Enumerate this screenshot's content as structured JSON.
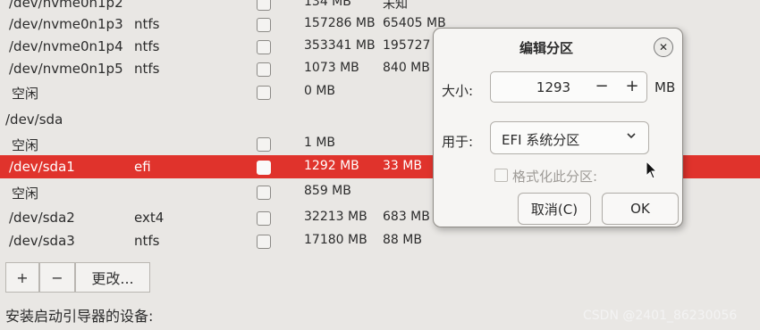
{
  "partitions": [
    {
      "device": "/dev/nvme0n1p2",
      "type": "",
      "size": "134 MB",
      "used": "未知",
      "selected": false
    },
    {
      "device": "/dev/nvme0n1p3",
      "type": "ntfs",
      "size": "157286 MB",
      "used": "65405 MB",
      "selected": false
    },
    {
      "device": "/dev/nvme0n1p4",
      "type": "ntfs",
      "size": "353341 MB",
      "used": "195727",
      "selected": false
    },
    {
      "device": "/dev/nvme0n1p5",
      "type": "ntfs",
      "size": "1073 MB",
      "used": "840 MB",
      "selected": false
    },
    {
      "device": "空闲",
      "type": "",
      "size": "0 MB",
      "used": "",
      "selected": false
    },
    {
      "device": "/dev/sda",
      "type": "",
      "size": "",
      "used": "",
      "selected": false,
      "disk": true
    },
    {
      "device": "空闲",
      "type": "",
      "size": "1 MB",
      "used": "",
      "selected": false
    },
    {
      "device": "/dev/sda1",
      "type": "efi",
      "size": "1292 MB",
      "used": "33 MB",
      "selected": true
    },
    {
      "device": "空闲",
      "type": "",
      "size": "859 MB",
      "used": "",
      "selected": false
    },
    {
      "device": "/dev/sda2",
      "type": "ext4",
      "size": "32213 MB",
      "used": "683 MB",
      "selected": false
    },
    {
      "device": "/dev/sda3",
      "type": "ntfs",
      "size": "17180 MB",
      "used": "88 MB",
      "selected": false
    }
  ],
  "toolbar": {
    "add_label": "+",
    "remove_label": "−",
    "change_label": "更改..."
  },
  "bootloader_label": "安装启动引导器的设备:",
  "watermark": "CSDN @2401_86230056",
  "dialog": {
    "title": "编辑分区",
    "size_label": "大小:",
    "size_value": "1293",
    "size_unit": "MB",
    "use_as_label": "用于:",
    "use_as_value": "EFI 系统分区",
    "format_label": "格式化此分区:",
    "format_checked": false,
    "cancel_label": "取消(C)",
    "ok_label": "OK"
  },
  "colors": {
    "selected_row": "#e0332c",
    "background": "#e9e7e4"
  }
}
